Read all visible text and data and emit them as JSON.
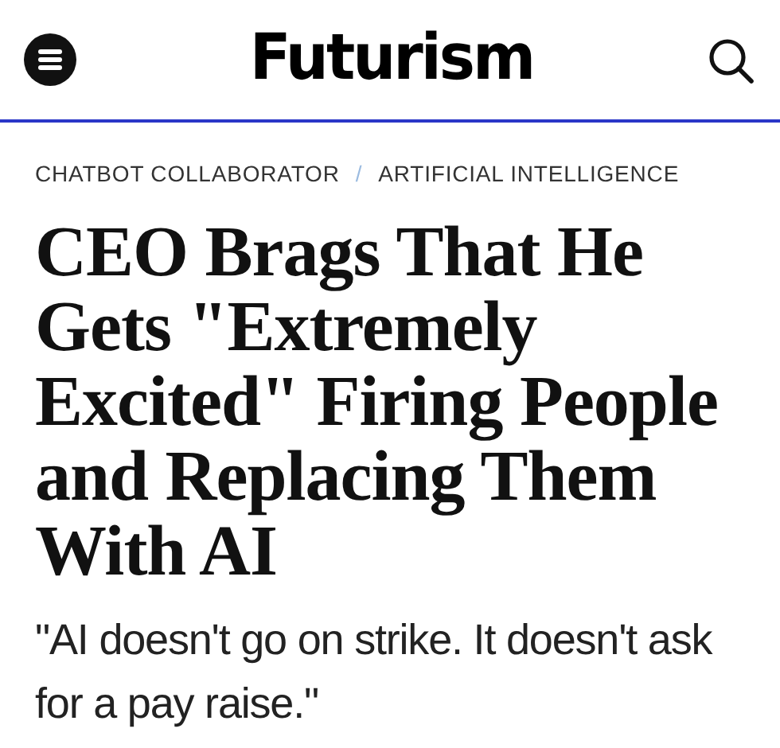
{
  "header": {
    "logo": "Futurism"
  },
  "breadcrumbs": {
    "items": [
      "CHATBOT COLLABORATOR",
      "ARTIFICIAL INTELLIGENCE"
    ],
    "separator": "/"
  },
  "article": {
    "headline": "CEO Brags That He Gets \"Extremely Excited\" Firing People and Replacing Them With AI",
    "subheadline": "\"AI doesn't go on strike. It doesn't ask for a pay raise.\""
  }
}
